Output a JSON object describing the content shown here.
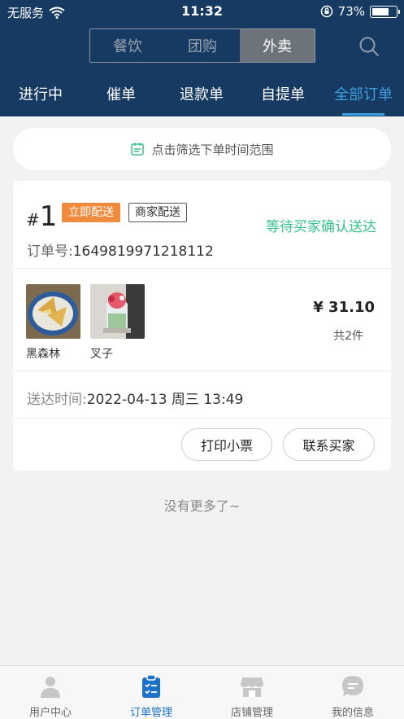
{
  "status_bar": {
    "carrier": "无服务",
    "time": "11:32",
    "battery": "73%",
    "battery_level": 0.73
  },
  "segment": {
    "items": [
      "餐饮",
      "团购",
      "外卖"
    ],
    "active_index": 2
  },
  "tabs": {
    "items": [
      "进行中",
      "催单",
      "退款单",
      "自提单",
      "全部订单"
    ],
    "active_index": 4
  },
  "filter": {
    "label": "点击筛选下单时间范围"
  },
  "order": {
    "hash": "#",
    "number": "1",
    "badge_primary": "立即配送",
    "badge_secondary": "商家配送",
    "status": "等待买家确认送达",
    "order_no_label": "订单号:",
    "order_no": "1649819971218112",
    "products": [
      {
        "name": "黑森林"
      },
      {
        "name": "叉子"
      }
    ],
    "price": "¥ 31.10",
    "count": "共2件",
    "delivery_label": "送达时间:",
    "delivery_time": "2022-04-13 周三 13:49",
    "buttons": {
      "print": "打印小票",
      "contact": "联系买家"
    }
  },
  "footer": {
    "no_more": "没有更多了~"
  },
  "bottom_nav": {
    "items": [
      {
        "label": "用户中心",
        "icon": "user-icon"
      },
      {
        "label": "订单管理",
        "icon": "clipboard-icon"
      },
      {
        "label": "店铺管理",
        "icon": "store-icon"
      },
      {
        "label": "我的信息",
        "icon": "chat-icon"
      }
    ],
    "active_index": 1
  },
  "colors": {
    "header": "#163a61",
    "accent_blue": "#3ea0e0",
    "status_green": "#36c38a",
    "badge_orange": "#f08a3c",
    "nav_active": "#1a73c9"
  }
}
